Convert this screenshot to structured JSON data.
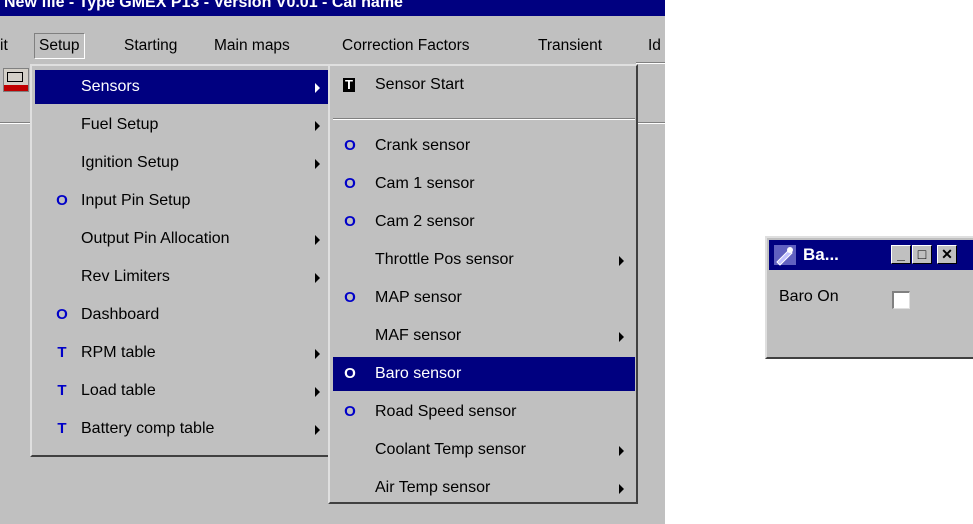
{
  "app": {
    "title_bar": "New file - Type GMEX P13 - Version V0.01 - Cal name"
  },
  "menubar": {
    "items": [
      {
        "label": "it",
        "key": "edit"
      },
      {
        "label": "Setup",
        "key": "setup"
      },
      {
        "label": "Starting",
        "key": "starting"
      },
      {
        "label": "Main maps",
        "key": "main_maps"
      },
      {
        "label": "Correction Factors",
        "key": "correction_factors"
      },
      {
        "label": "Transient",
        "key": "transient"
      },
      {
        "label": "Id",
        "key": "idle"
      }
    ]
  },
  "setup_menu": {
    "items": [
      {
        "label": "Sensors",
        "glyph": "",
        "submenu": true,
        "selected": true
      },
      {
        "label": "Fuel Setup",
        "glyph": "",
        "submenu": true
      },
      {
        "label": "Ignition Setup",
        "glyph": "",
        "submenu": true
      },
      {
        "label": "Input Pin Setup",
        "glyph": "O",
        "submenu": false
      },
      {
        "label": "Output Pin Allocation",
        "glyph": "",
        "submenu": true
      },
      {
        "label": "Rev Limiters",
        "glyph": "",
        "submenu": true
      },
      {
        "label": "Dashboard",
        "glyph": "O",
        "submenu": false
      },
      {
        "label": "RPM table",
        "glyph": "T",
        "submenu": true
      },
      {
        "label": "Load table",
        "glyph": "T",
        "submenu": true
      },
      {
        "label": "Battery comp table",
        "glyph": "T",
        "submenu": true
      }
    ]
  },
  "sensors_menu": {
    "items": [
      {
        "label": "Sensor Start",
        "glyph": "T",
        "submenu": false
      },
      {
        "label": "Crank sensor",
        "glyph": "O",
        "submenu": false
      },
      {
        "label": "Cam 1 sensor",
        "glyph": "O",
        "submenu": false
      },
      {
        "label": "Cam 2 sensor",
        "glyph": "O",
        "submenu": false
      },
      {
        "label": "Throttle Pos sensor",
        "glyph": "",
        "submenu": true
      },
      {
        "label": "MAP sensor",
        "glyph": "O",
        "submenu": false
      },
      {
        "label": "MAF sensor",
        "glyph": "",
        "submenu": true
      },
      {
        "label": "Baro sensor",
        "glyph": "O",
        "submenu": false,
        "selected": true
      },
      {
        "label": "Road Speed sensor",
        "glyph": "O",
        "submenu": false
      },
      {
        "label": "Coolant Temp sensor",
        "glyph": "",
        "submenu": true
      },
      {
        "label": "Air Temp sensor",
        "glyph": "",
        "submenu": true
      }
    ]
  },
  "baro_window": {
    "title": "Ba...",
    "minimize": "_",
    "maximize": "□",
    "close": "✕",
    "checkbox_label": "Baro On",
    "checked": false
  },
  "colors": {
    "menu_bg": "#c0c0c0",
    "selection": "#000080",
    "glyph": "#0000c8"
  }
}
